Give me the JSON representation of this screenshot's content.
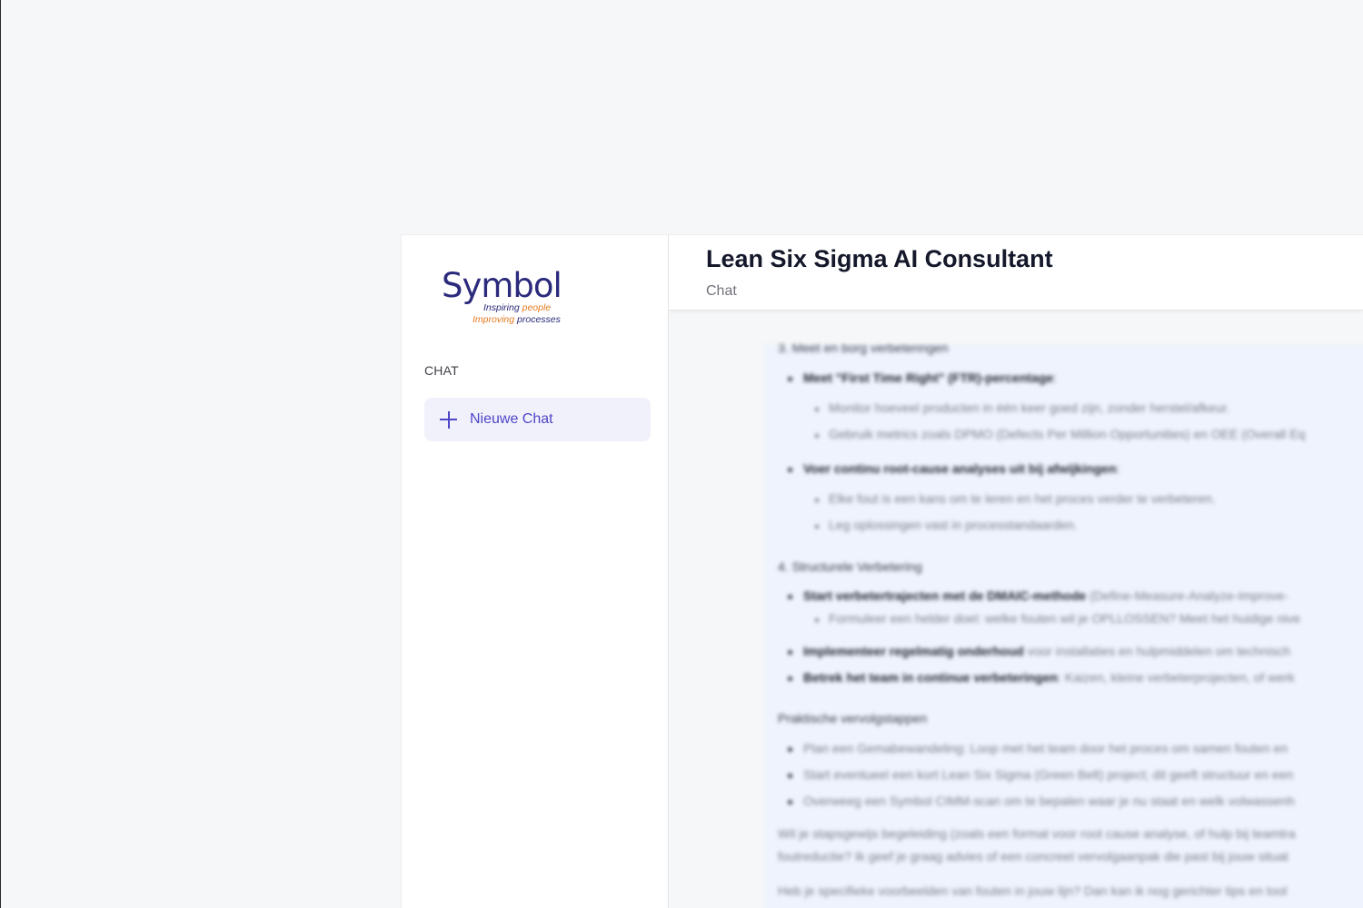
{
  "sidebar": {
    "logo": {
      "wordmark": "Symbol",
      "tagline_1_a": "Inspiring",
      "tagline_1_b": "people",
      "tagline_2_a": "Improving",
      "tagline_2_b": "processes"
    },
    "section_label": "CHAT",
    "new_chat_label": "Nieuwe Chat",
    "new_chat_icon": "plus-icon"
  },
  "header": {
    "title": "Lean Six Sigma AI Consultant",
    "subtitle": "Chat"
  },
  "message": {
    "heading_3": "3. Meet en borg verbeteringen",
    "b1_bold": "Meet \"First Time Right\" (FTR)-percentage",
    "b1_s1": "Monitor hoeveel producten in één keer goed zijn, zonder herstel/afkeur.",
    "b1_s2": "Gebruik metrics zoals DPMO (Defects Per Million Opportunities) en OEE (Overall Eq",
    "b2_bold": "Voer continu root-cause analyses uit bij afwijkingen",
    "b2_s1": "Elke fout is een kans om te leren en het proces verder te verbeteren.",
    "b2_s2": "Leg oplossingen vast in processtandaarden.",
    "heading_4": "4. Structurele Verbetering",
    "b3_bold": "Start verbetertrajecten met de DMAIC-methode",
    "b3_rest": "(Define-Measure-Analyze-Improve-",
    "b3_s1": "Formuleer een helder doel: welke fouten wil je OPLLOSSEN? Meet het huidige nive",
    "b4_bold": "Implementeer regelmatig onderhoud",
    "b4_rest": "voor installaties en hulpmiddelen om technisch",
    "b5_bold": "Betrek het team in continue verbeteringen",
    "b5_rest": ": Kaizen, kleine verbeterprojecten, of werk",
    "heading_steps": "Praktische vervolgstappen",
    "s1": "Plan een Gemabewandeling: Loop met het team door het proces om samen fouten en",
    "s2": "Start eventueel een kort Lean Six Sigma (Green Belt) project; dit geeft structuur en een",
    "s3": "Overweeg een Symbol CIMM-scan om te bepalen waar je nu staat en welk volwassenh",
    "p1_line1": "Wil je stapsgewijs begeleiding (zoals een format voor root cause analyse, of hulp bij teamtra",
    "p1_line2": "foutreductie? Ik geef je graag advies of een concreet vervolgaanpak die past bij jouw situat",
    "p2_line1": "Heb je specifieke voorbeelden van fouten in jouw lijn? Dan kan ik nog gerichter tips en tool"
  },
  "colors": {
    "brand_dark": "#2c2a7c",
    "brand_orange": "#e2791d",
    "accent": "#4f46c8",
    "new_chat_bg": "#f1f1fb",
    "message_bg": "#eef3fd"
  }
}
